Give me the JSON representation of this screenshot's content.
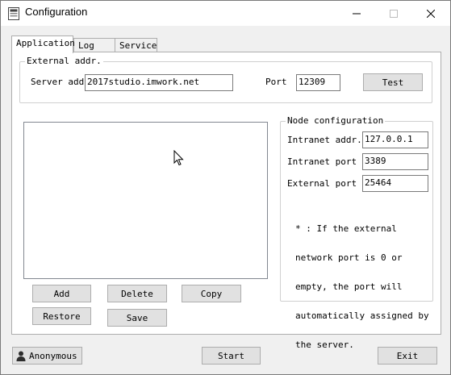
{
  "window": {
    "title": "Configuration"
  },
  "tabs": [
    {
      "label": "Application"
    },
    {
      "label": "Log"
    },
    {
      "label": "Service"
    }
  ],
  "external_addr": {
    "group_label": "External addr.",
    "server_label": "Server addr",
    "server_value": "2017studio.imwork.net",
    "port_label": "Port",
    "port_value": "12309",
    "test_label": "Test"
  },
  "node_config": {
    "group_label": "Node configuration",
    "intranet_addr_label": "Intranet addr.",
    "intranet_addr_value": "127.0.0.1",
    "intranet_port_label": "Intranet port",
    "intranet_port_value": "3389",
    "external_port_label": "External port (*",
    "external_port_value": "25464",
    "note_lines": [
      "* : If the external",
      "network port is 0 or",
      "empty, the port will",
      "automatically assigned by",
      "the server."
    ]
  },
  "list_buttons": {
    "add": "Add",
    "delete": "Delete",
    "copy": "Copy",
    "restore": "Restore",
    "save": "Save"
  },
  "footer": {
    "user_label": "Anonymous",
    "start_label": "Start",
    "exit_label": "Exit"
  }
}
